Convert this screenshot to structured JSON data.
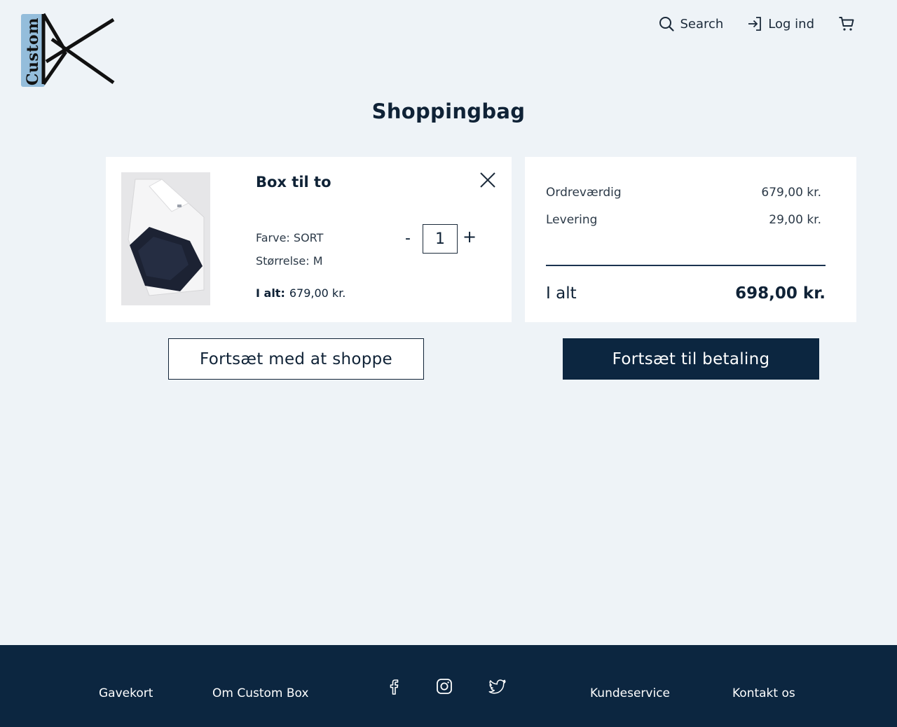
{
  "brand": {
    "logo_text": "Custom",
    "logo_mark": "BX"
  },
  "header": {
    "search_label": "Search",
    "search_icon": "search-icon",
    "login_label": "Log ind",
    "login_icon": "login-icon",
    "cart_icon": "cart-icon"
  },
  "page": {
    "title": "Shoppingbag"
  },
  "cart_item": {
    "name": "Box til to",
    "color_text": "Farve: SORT",
    "size_text": "Størrelse: M",
    "total_label": "I alt:",
    "total_value": "679,00 kr.",
    "quantity": "1",
    "minus_label": "-",
    "plus_label": "+",
    "remove_icon": "close-icon"
  },
  "summary": {
    "order_label": "Ordreværdig",
    "order_value": "679,00 kr.",
    "delivery_label": "Levering",
    "delivery_value": "29,00 kr.",
    "total_label": "I alt",
    "total_value": "698,00 kr."
  },
  "actions": {
    "continue_shopping": "Fortsæt med at shoppe",
    "checkout": "Fortsæt til betaling"
  },
  "footer": {
    "gift_card": "Gavekort",
    "about": "Om Custom Box",
    "customer_service": "Kundeservice",
    "contact": "Kontakt os",
    "social_icons": [
      "facebook-icon",
      "instagram-icon",
      "twitter-icon"
    ]
  },
  "colors": {
    "page_bg": "#eef3f7",
    "navy": "#0c2640",
    "card_bg": "#ffffff",
    "logo_blue": "#84b3d6"
  }
}
